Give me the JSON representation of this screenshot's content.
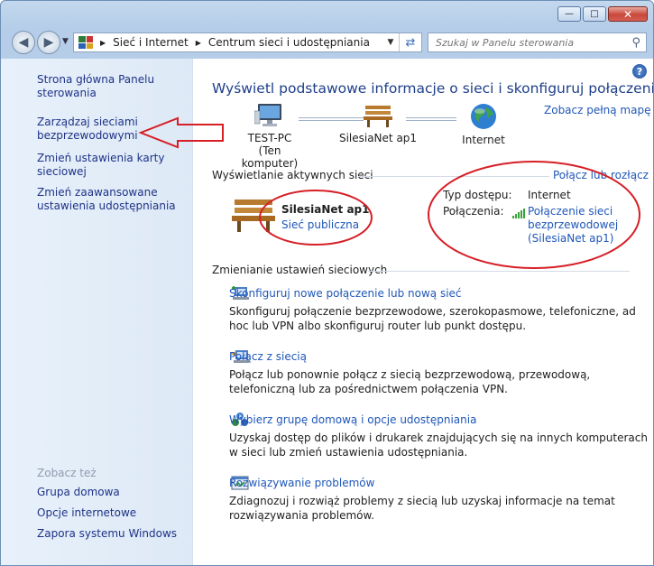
{
  "window": {
    "minimize": "—",
    "maximize": "□",
    "close": "✕"
  },
  "navbar": {
    "back_icon": "arrow-left-icon",
    "forward_icon": "arrow-right-icon",
    "breadcrumb": [
      "Sieć i Internet",
      "Centrum sieci i udostępniania"
    ],
    "search_placeholder": "Szukaj w Panelu sterowania"
  },
  "sidebar": {
    "items": [
      {
        "label": "Strona główna Panelu sterowania"
      },
      {
        "label": "Zarządzaj sieciami bezprzewodowymi"
      },
      {
        "label": "Zmień ustawienia karty sieciowej"
      },
      {
        "label": "Zmień zaawansowane ustawienia udostępniania"
      }
    ],
    "see_also_title": "Zobacz też",
    "see_also": [
      {
        "label": "Grupa domowa"
      },
      {
        "label": "Opcje internetowe"
      },
      {
        "label": "Zapora systemu Windows"
      }
    ]
  },
  "main": {
    "help": "?",
    "heading": "Wyświetl podstawowe informacje o sieci i skonfiguruj połączenia",
    "see_full_map": "Zobacz pełną mapę",
    "map": {
      "computer": {
        "name": "TEST-PC",
        "sub": "(Ten komputer)"
      },
      "network": {
        "name": "SilesiaNet ap1"
      },
      "internet": {
        "name": "Internet"
      }
    },
    "active_section_title": "Wyświetlanie aktywnych sieci",
    "connect_disconnect": "Połącz lub rozłącz",
    "active_network": {
      "name": "SilesiaNet ap1",
      "type": "Sieć publiczna",
      "access_type_label": "Typ dostępu:",
      "access_type_value": "Internet",
      "connections_label": "Połączenia:",
      "connections_value": "Połączenie sieci bezprzewodowej (SilesiaNet ap1)"
    },
    "change_section_title": "Zmienianie ustawień sieciowych",
    "tasks": [
      {
        "link": "Skonfiguruj nowe połączenie lub nową sieć",
        "desc": "Skonfiguruj połączenie bezprzewodowe, szerokopasmowe, telefoniczne, ad hoc lub VPN albo skonfiguruj router lub punkt dostępu."
      },
      {
        "link": "Połącz z siecią",
        "desc": "Połącz lub ponownie połącz z siecią bezprzewodową, przewodową, telefoniczną lub za pośrednictwem połączenia VPN."
      },
      {
        "link": "Wybierz grupę domową i opcje udostępniania",
        "desc": "Uzyskaj dostęp do plików i drukarek znajdujących się na innych komputerach w sieci lub zmień ustawienia udostępniania."
      },
      {
        "link": "Rozwiązywanie problemów",
        "desc": "Zdiagnozuj i rozwiąż problemy z siecią lub uzyskaj informacje na temat rozwiązywania problemów."
      }
    ]
  },
  "annotation_color": "#d61f26"
}
